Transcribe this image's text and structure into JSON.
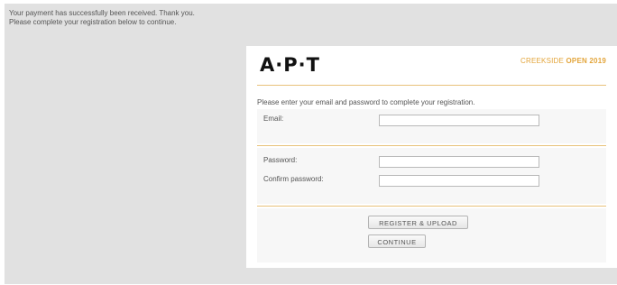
{
  "notice": {
    "line1": "Your payment has successfully been received. Thank you.",
    "line2": "Please complete your registration below to continue."
  },
  "brand": {
    "logo": "A·P·T",
    "event_prefix": "CREEKSIDE",
    "event_bold": "OPEN 2019"
  },
  "form": {
    "intro": "Please enter your email and password to complete your registration.",
    "email_label": "Email:",
    "email_value": "",
    "password_label": "Password:",
    "password_value": "",
    "confirm_label": "Confirm password:",
    "confirm_value": ""
  },
  "buttons": {
    "register_upload": "REGISTER & UPLOAD",
    "continue": "CONTINUE"
  },
  "colors": {
    "accent": "#e3a53b",
    "background": "#e1e1e1"
  }
}
